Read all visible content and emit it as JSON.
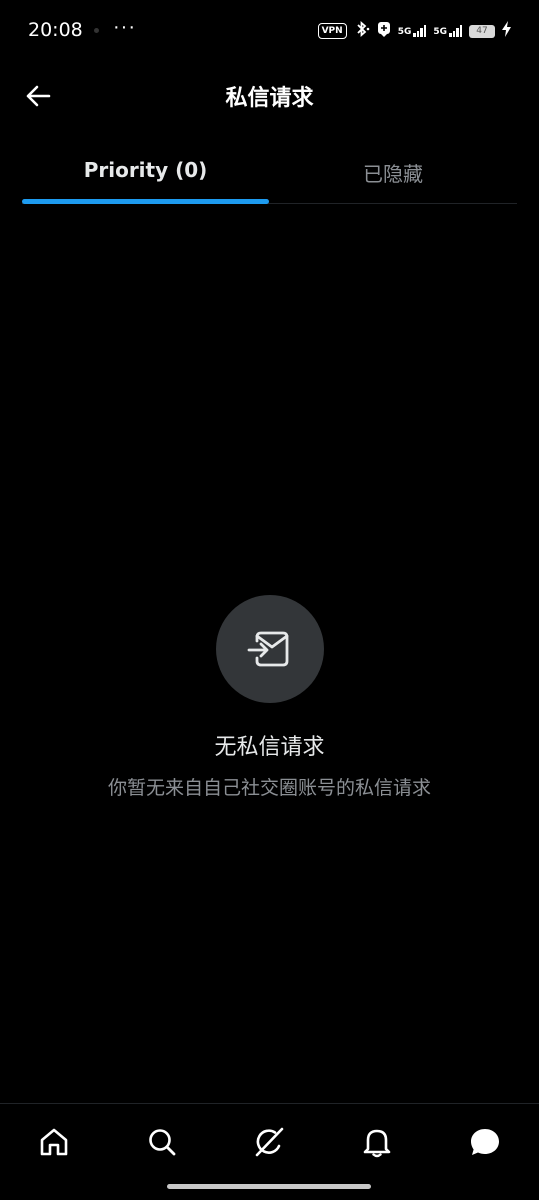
{
  "status_bar": {
    "time": "20:08",
    "more": "···",
    "vpn": "VPN",
    "net1": "5G",
    "net2": "5G",
    "battery": "47"
  },
  "header": {
    "title": "私信请求",
    "back_icon": "arrow-left-icon"
  },
  "tabs": [
    {
      "label": "Priority (0)",
      "active": true
    },
    {
      "label": "已隐藏",
      "active": false
    }
  ],
  "empty_state": {
    "icon": "message-request-icon",
    "title": "无私信请求",
    "description": "你暂无来自自己社交圈账号的私信请求"
  },
  "bottom_nav": [
    {
      "name": "home",
      "icon": "home-icon"
    },
    {
      "name": "search",
      "icon": "search-icon"
    },
    {
      "name": "grok",
      "icon": "grok-icon"
    },
    {
      "name": "notifications",
      "icon": "bell-icon"
    },
    {
      "name": "messages",
      "icon": "message-icon",
      "active": true
    }
  ],
  "colors": {
    "background": "#000000",
    "accent": "#1d9bf0",
    "secondary_text": "#8b8f94",
    "icon_circle": "#333639"
  }
}
